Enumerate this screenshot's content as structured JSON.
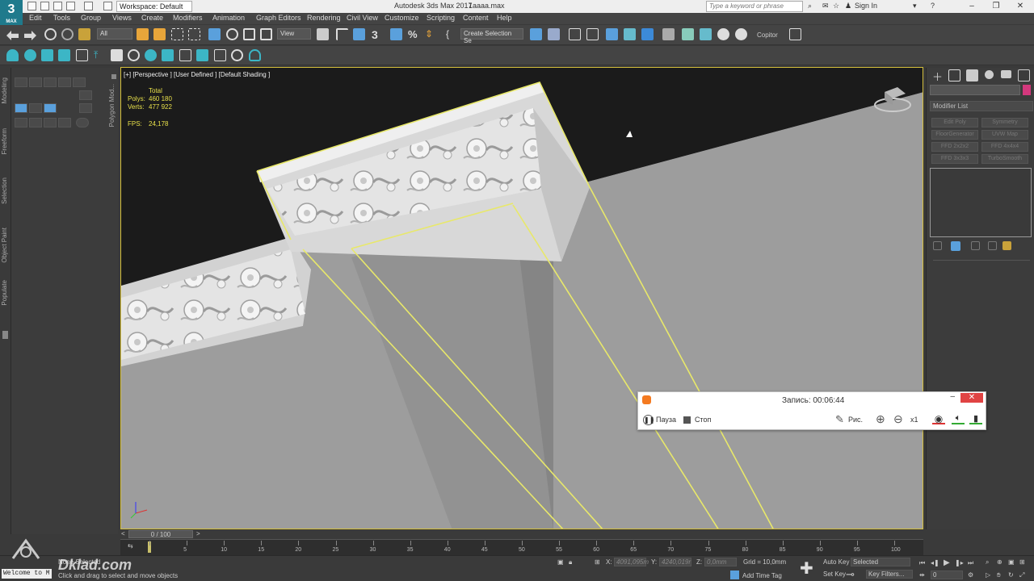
{
  "app": {
    "logo_text": "3",
    "logo_sub": "MAX",
    "workspace": "Workspace: Default",
    "title": "Autodesk 3ds Max 2017",
    "file": "1aaaa.max",
    "search_placeholder": "Type a keyword or phrase",
    "sign_in": "Sign In"
  },
  "menu": [
    "Edit",
    "Tools",
    "Group",
    "Views",
    "Create",
    "Modifiers",
    "Animation",
    "Graph Editors",
    "Rendering",
    "Civil View",
    "Customize",
    "Scripting",
    "Content",
    "Help"
  ],
  "toolbar": {
    "filter": "All",
    "view": "View",
    "snap_label": "3",
    "selection_set": "Create Selection Se",
    "copitor": "Copitor"
  },
  "left_tabs": [
    "Modeling",
    "Freeform",
    "Selection",
    "Object Paint",
    "Populate"
  ],
  "left_panel_label": "Polygon Mod...",
  "viewport": {
    "label": "[+] [Perspective ] [User Defined ] [Default Shading ]",
    "stats_header": "Total",
    "polys_label": "Polys:",
    "polys": "460 180",
    "verts_label": "Verts:",
    "verts": "477 922",
    "fps_label": "FPS:",
    "fps": "24,178"
  },
  "modifier_panel": {
    "list_label": "Modifier List",
    "buttons": [
      "Edit Poly",
      "Symmetry",
      "FloorGenerator",
      "UVW Map",
      "FFD 2x2x2",
      "FFD 4x4x4",
      "FFD 3x3x3",
      "TurboSmooth"
    ]
  },
  "recorder": {
    "title": "Запись:  00:06:44",
    "pause": "Пауза",
    "stop": "Стоп",
    "draw": "Рис.",
    "zoom": "x1"
  },
  "timeline": {
    "slider": "0 / 100",
    "ticks": [
      0,
      5,
      10,
      15,
      20,
      25,
      30,
      35,
      40,
      45,
      50,
      55,
      60,
      65,
      70,
      75,
      80,
      85,
      90,
      95,
      100
    ]
  },
  "status": {
    "selection": "None Selected",
    "hint": "Click and drag to select and move objects",
    "x_label": "X:",
    "x_value": "4091,095m",
    "y_label": "Y:",
    "y_value": "4240,019r",
    "z_label": "Z:",
    "z_value": "0,0mm",
    "grid": "Grid = 10,0mm",
    "add_time_tag": "Add Time Tag",
    "auto_key": "Auto Key",
    "set_key": "Set Key",
    "selected": "Selected",
    "key_filters": "Key Filters...",
    "frame": "0",
    "script_listener": "Welcome to M"
  },
  "watermark": "Dklad.com",
  "colors": {
    "accent": "#1f7a8c",
    "viewport_border": "#d4bf3c",
    "highlight": "#e8e04a",
    "record_red": "#e04343"
  }
}
